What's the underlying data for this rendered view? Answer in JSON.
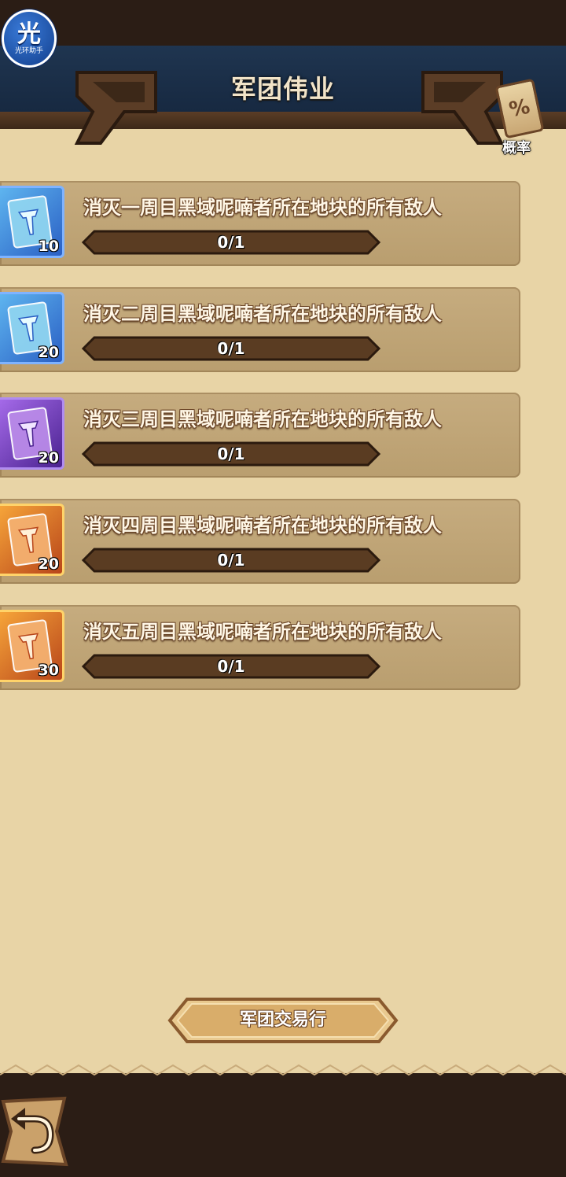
{
  "app_badge": {
    "char": "光",
    "caption": "光环助手"
  },
  "header": {
    "title": "军团伟业"
  },
  "probability_button": {
    "label": "概率",
    "icon": "percent-scroll-icon"
  },
  "tasks": [
    {
      "desc": "消灭一周目黑域呢喃者所在地块的所有敌人",
      "count": "10",
      "progress_text": "0/1",
      "progress": 0,
      "tier": "blue",
      "icon": "blue-banner-card-icon"
    },
    {
      "desc": "消灭二周目黑域呢喃者所在地块的所有敌人",
      "count": "20",
      "progress_text": "0/1",
      "progress": 0,
      "tier": "blue",
      "icon": "blue-banner-card-icon"
    },
    {
      "desc": "消灭三周目黑域呢喃者所在地块的所有敌人",
      "count": "20",
      "progress_text": "0/1",
      "progress": 0,
      "tier": "purple",
      "icon": "purple-banner-card-icon"
    },
    {
      "desc": "消灭四周目黑域呢喃者所在地块的所有敌人",
      "count": "20",
      "progress_text": "0/1",
      "progress": 0,
      "tier": "orange",
      "icon": "orange-banner-card-icon"
    },
    {
      "desc": "消灭五周目黑域呢喃者所在地块的所有敌人",
      "count": "30",
      "progress_text": "0/1",
      "progress": 0,
      "tier": "orange",
      "icon": "orange-banner-card-icon"
    }
  ],
  "trade_button": {
    "label": "军团交易行"
  },
  "back_button": {
    "icon": "back-arrow-icon"
  },
  "colors": {
    "parchment": "#e8d4a6",
    "card": "#c1a677",
    "dark_wood": "#2b1d15",
    "tier_blue": "#3f7fd6",
    "tier_purple": "#7a3fc4",
    "tier_orange": "#e07a22"
  }
}
